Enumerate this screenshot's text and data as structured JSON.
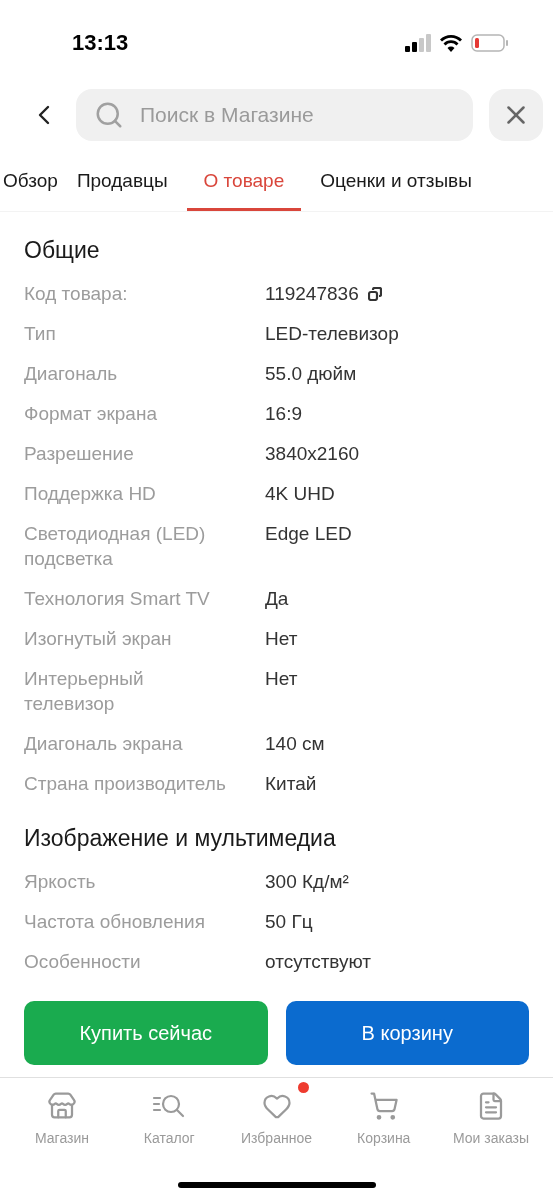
{
  "status_bar": {
    "time": "13:13"
  },
  "search": {
    "placeholder": "Поиск в Магазине"
  },
  "tabs": [
    {
      "label": "Обзор",
      "selected": false
    },
    {
      "label": "Продавцы",
      "selected": false
    },
    {
      "label": "О товаре",
      "selected": true
    },
    {
      "label": "Оценки и отзывы",
      "selected": false
    }
  ],
  "sections": [
    {
      "title": "Общие",
      "rows": [
        {
          "label": "Код товара:",
          "value": "119247836",
          "kind": "code"
        },
        {
          "label": "Тип",
          "value": "LED-телевизор",
          "kind": "text"
        },
        {
          "label": "Диагональ",
          "value": "55.0 дюйм",
          "kind": "text"
        },
        {
          "label": "Формат экрана",
          "value": "16:9",
          "kind": "text"
        },
        {
          "label": "Разрешение",
          "value": "3840x2160",
          "kind": "text"
        },
        {
          "label": "Поддержка HD",
          "value": "4K UHD",
          "kind": "text"
        },
        {
          "label": "Светодиодная (LED) подсветка",
          "value": "Edge LED",
          "kind": "text"
        },
        {
          "label": "Технология Smart TV",
          "value": "Да",
          "kind": "text"
        },
        {
          "label": "Изогнутый экран",
          "value": "Нет",
          "kind": "text"
        },
        {
          "label": "Интерьерный телевизор",
          "value": "Нет",
          "kind": "text"
        },
        {
          "label": "Диагональ экрана",
          "value": "140 см",
          "kind": "text"
        },
        {
          "label": "Страна производитель",
          "value": "Китай",
          "kind": "text"
        }
      ]
    },
    {
      "title": "Изображение и мультимедиа",
      "rows": [
        {
          "label": "Яркость",
          "value": "300 Кд/м²",
          "kind": "text"
        },
        {
          "label": "Частота обновления",
          "value": "50 Гц",
          "kind": "text"
        },
        {
          "label": "Особенности",
          "value": "отсутствуют",
          "kind": "text"
        }
      ]
    }
  ],
  "actions": [
    {
      "label": "Купить сейчас",
      "kind": "buy"
    },
    {
      "label": "В корзину",
      "kind": "cart"
    }
  ],
  "nav": [
    {
      "label": "Магазин",
      "kind": "store",
      "notification": false
    },
    {
      "label": "Каталог",
      "kind": "catalog",
      "notification": false
    },
    {
      "label": "Избранное",
      "kind": "favorites",
      "notification": true
    },
    {
      "label": "Корзина",
      "kind": "cart",
      "notification": false
    },
    {
      "label": "Мои заказы",
      "kind": "orders",
      "notification": false
    }
  ]
}
